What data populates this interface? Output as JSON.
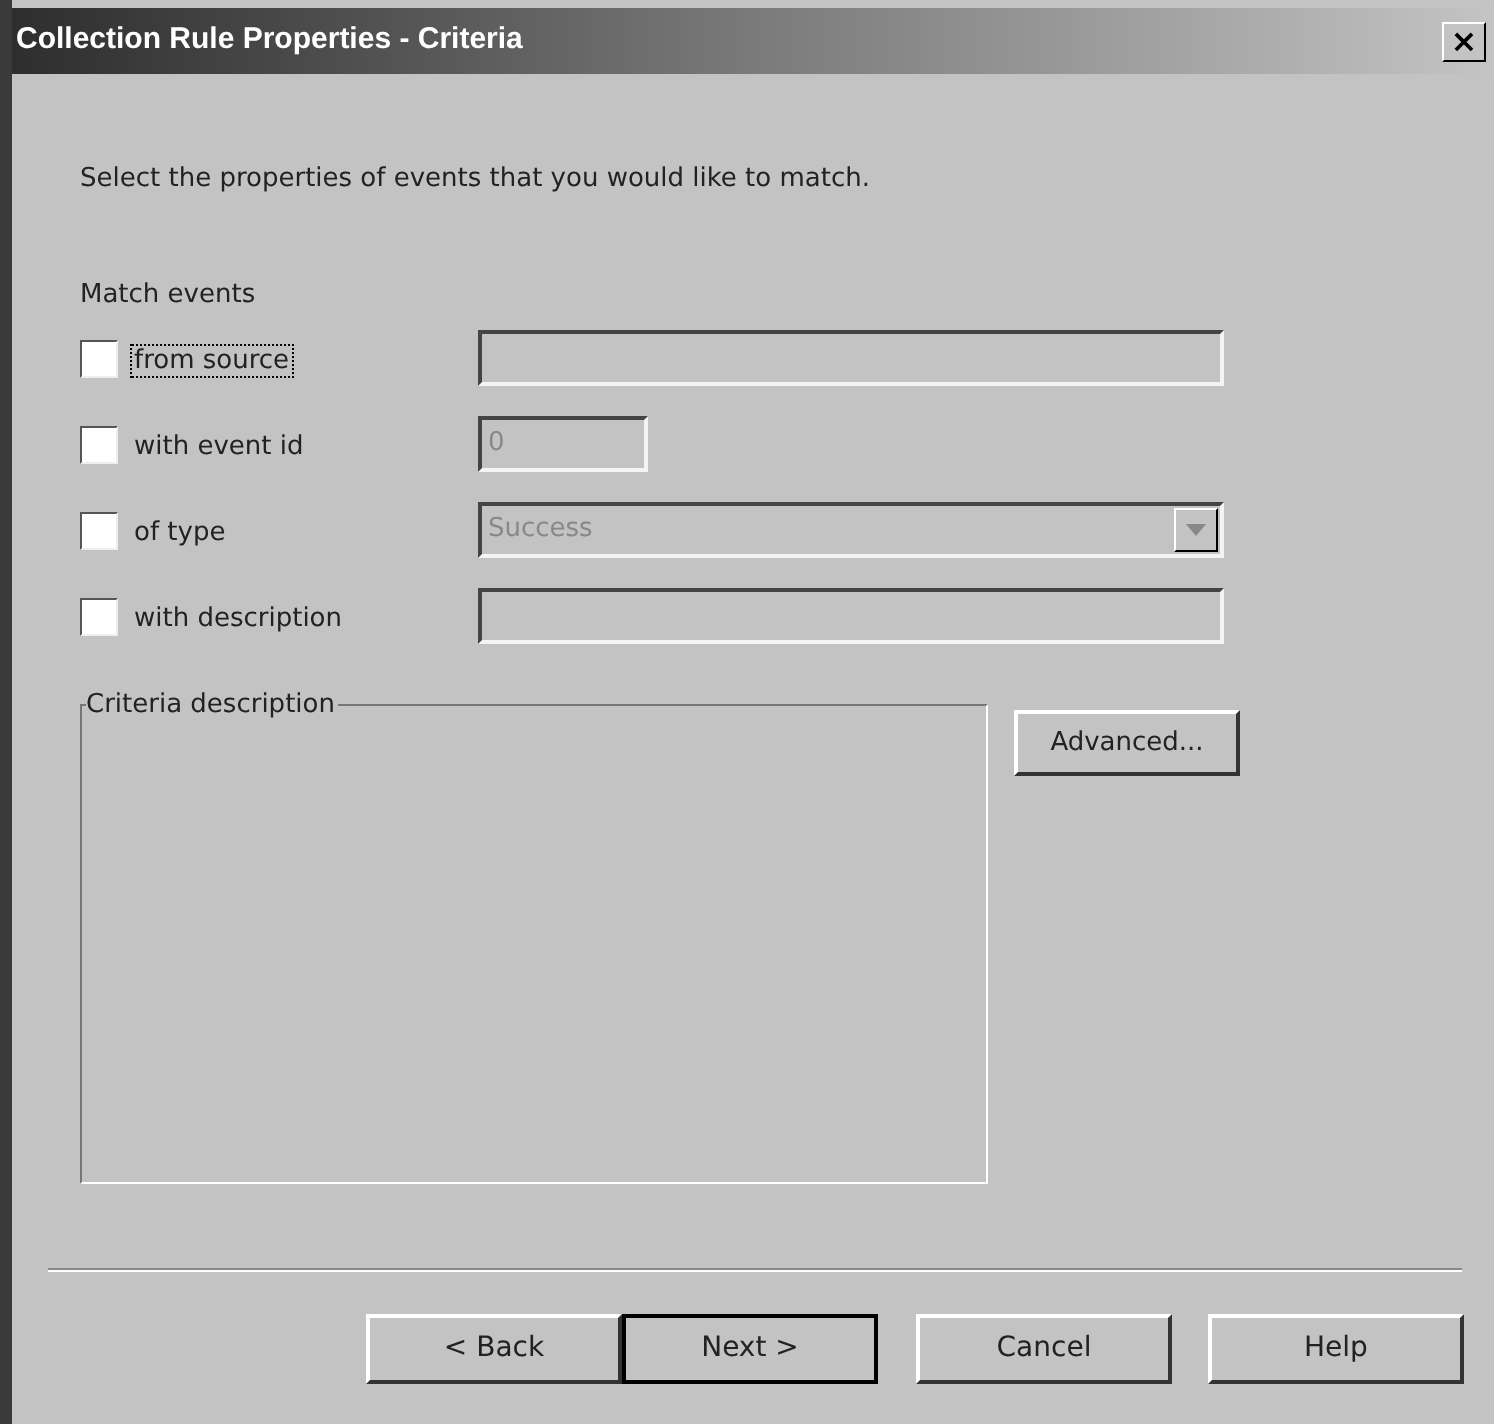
{
  "window": {
    "title": "Collection Rule Properties - Criteria",
    "close": "×"
  },
  "intro": "Select the properties of events that you would like to match.",
  "match_label": "Match events",
  "criteria": [
    {
      "label": "from source",
      "checked": false,
      "focused": true,
      "kind": "text",
      "disabled": true
    },
    {
      "label": "with event id",
      "checked": false,
      "focused": false,
      "kind": "number",
      "value": "0",
      "disabled": true
    },
    {
      "label": "of type",
      "checked": false,
      "focused": false,
      "kind": "combo",
      "value": "Success",
      "disabled": true
    },
    {
      "label": "with description",
      "checked": false,
      "focused": false,
      "kind": "text",
      "disabled": true
    }
  ],
  "group": {
    "title": "Criteria description"
  },
  "advanced_button": "Advanced...",
  "buttons": [
    {
      "label": "< Back",
      "default": false
    },
    {
      "label": "Next >",
      "default": true
    },
    {
      "label": "Cancel",
      "default": false
    },
    {
      "label": "Help",
      "default": false
    }
  ]
}
